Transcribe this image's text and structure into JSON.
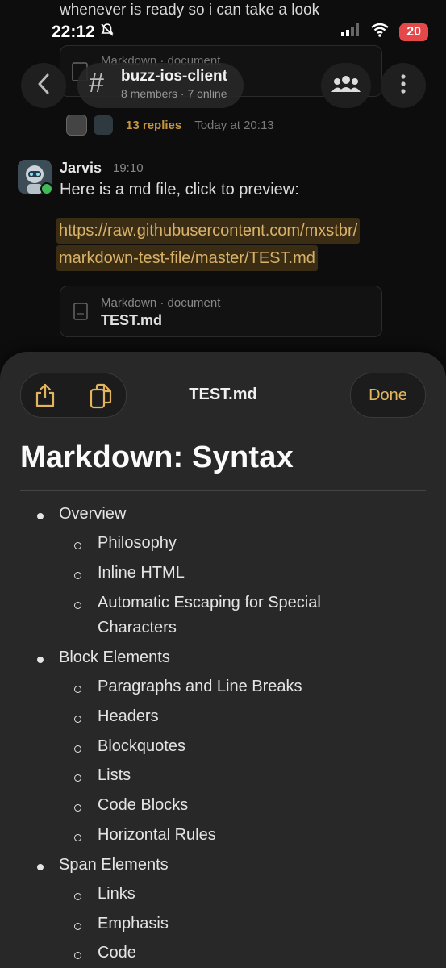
{
  "background": {
    "previous_message": "whenever is ready so i can take a look",
    "status_bar": {
      "time": "22:12",
      "battery": "20"
    },
    "top_doc_card": {
      "kind": "Markdown · document"
    },
    "nav": {
      "channel_hash": "#",
      "channel_name": "buzz-ios-client",
      "channel_meta": "8 members · 7 online"
    },
    "thread": {
      "replies": "13 replies",
      "time": "Today at 20:13"
    },
    "message": {
      "author": "Jarvis",
      "time": "19:10",
      "text": "Here is a md file, click to preview:",
      "link_line1": "https://raw.githubusercontent.com/mxstbr/",
      "link_line2": "markdown-test-file/master/TEST.md",
      "doc_kind": "Markdown · document",
      "doc_name": "TEST.md"
    }
  },
  "sheet": {
    "title": "TEST.md",
    "done_label": "Done",
    "heading": "Markdown: Syntax",
    "list": [
      {
        "text": "Overview",
        "level": 1
      },
      {
        "text": "Philosophy",
        "level": 2
      },
      {
        "text": "Inline HTML",
        "level": 2
      },
      {
        "text": "Automatic Escaping for Special",
        "level": 2
      },
      {
        "text": "Characters",
        "level": 0
      },
      {
        "text": "Block Elements",
        "level": 1
      },
      {
        "text": "Paragraphs and Line Breaks",
        "level": 2
      },
      {
        "text": "Headers",
        "level": 2
      },
      {
        "text": "Blockquotes",
        "level": 2
      },
      {
        "text": "Lists",
        "level": 2
      },
      {
        "text": "Code Blocks",
        "level": 2
      },
      {
        "text": "Horizontal Rules",
        "level": 2
      },
      {
        "text": "Span Elements",
        "level": 1
      },
      {
        "text": "Links",
        "level": 2
      },
      {
        "text": "Emphasis",
        "level": 2
      },
      {
        "text": "Code",
        "level": 2
      }
    ]
  },
  "colors": {
    "accent": "#e3b55f",
    "link": "#d9b26a",
    "online": "#3fba57",
    "battery": "#e54848"
  },
  "icons": [
    "bell-slash-icon",
    "signal-icon",
    "wifi-icon",
    "back-chevron-icon",
    "members-icon",
    "more-vertical-icon",
    "document-icon",
    "share-icon",
    "copy-icon"
  ]
}
